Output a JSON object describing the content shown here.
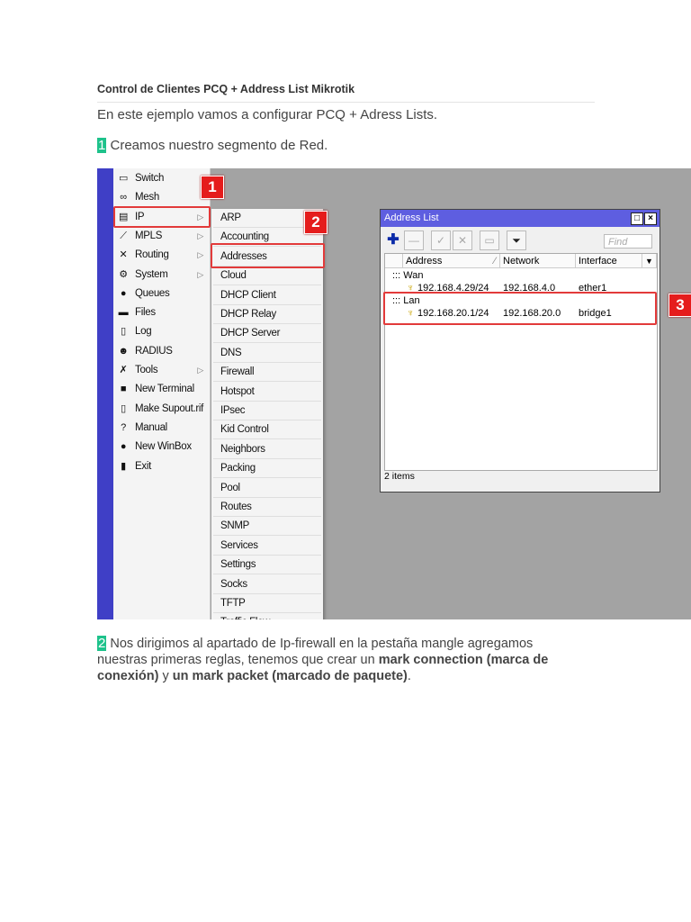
{
  "article": {
    "title": "Control de Clientes PCQ + Address List Mikrotik",
    "intro": "En este ejemplo vamos a configurar PCQ + Adress Lists.",
    "step1": {
      "num": "1",
      "text": " Creamos nuestro segmento de Red."
    },
    "step2": {
      "num": "2",
      "text_a": " Nos dirigimos al apartado de Ip-firewall en la pestaña mangle agregamos nuestras primeras reglas, tenemos que crear un ",
      "bold_a": "mark connection (marca de conexión)",
      "text_b": " y ",
      "bold_b": "un mark packet (marcado de paquete)",
      "text_c": "."
    }
  },
  "menu": [
    {
      "label": "Switch",
      "icon": "switch-icon",
      "glyph": "▭"
    },
    {
      "label": "Mesh",
      "icon": "mesh-icon",
      "glyph": "∞"
    },
    {
      "label": "IP",
      "icon": "ip-icon",
      "glyph": "▤",
      "arrow": "▷"
    },
    {
      "label": "MPLS",
      "icon": "mpls-icon",
      "glyph": "⟋",
      "arrow": "▷"
    },
    {
      "label": "Routing",
      "icon": "routing-icon",
      "glyph": "✕",
      "arrow": "▷"
    },
    {
      "label": "System",
      "icon": "gear-icon",
      "glyph": "⚙",
      "arrow": "▷"
    },
    {
      "label": "Queues",
      "icon": "queues-icon",
      "glyph": "●"
    },
    {
      "label": "Files",
      "icon": "folder-icon",
      "glyph": "▬"
    },
    {
      "label": "Log",
      "icon": "log-icon",
      "glyph": "▯"
    },
    {
      "label": "RADIUS",
      "icon": "radius-icon",
      "glyph": "☻"
    },
    {
      "label": "Tools",
      "icon": "tools-icon",
      "glyph": "✗",
      "arrow": "▷"
    },
    {
      "label": "New Terminal",
      "icon": "terminal-icon",
      "glyph": "■"
    },
    {
      "label": "Make Supout.rif",
      "icon": "file-icon",
      "glyph": "▯"
    },
    {
      "label": "Manual",
      "icon": "help-icon",
      "glyph": "?"
    },
    {
      "label": "New WinBox",
      "icon": "winbox-icon",
      "glyph": "●"
    },
    {
      "label": "Exit",
      "icon": "exit-icon",
      "glyph": "▮"
    }
  ],
  "submenu": [
    "ARP",
    "Accounting",
    "Addresses",
    "Cloud",
    "DHCP Client",
    "DHCP Relay",
    "DHCP Server",
    "DNS",
    "Firewall",
    "Hotspot",
    "IPsec",
    "Kid Control",
    "Neighbors",
    "Packing",
    "Pool",
    "Routes",
    "SNMP",
    "Services",
    "Settings",
    "Socks",
    "TFTP",
    "Traffic Flow"
  ],
  "callouts": [
    "1",
    "2",
    "3"
  ],
  "window": {
    "title": "Address List",
    "find_placeholder": "Find",
    "columns": [
      "Address",
      "Network",
      "Interface"
    ],
    "rows": [
      {
        "type": "group",
        "label": "::: Wan"
      },
      {
        "type": "item",
        "address": "192.168.4.29/24",
        "network": "192.168.4.0",
        "interface": "ether1"
      },
      {
        "type": "group",
        "label": "::: Lan"
      },
      {
        "type": "item",
        "address": "192.168.20.1/24",
        "network": "192.168.20.0",
        "interface": "bridge1"
      }
    ],
    "count": "2 items"
  },
  "colors": {
    "accent": "#1ec28b",
    "callout": "#e51c1c",
    "winbox_title": "#5e5ee0"
  }
}
